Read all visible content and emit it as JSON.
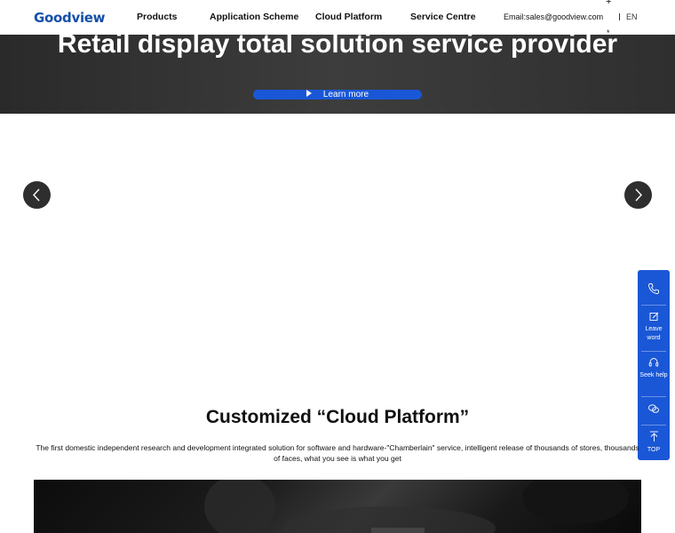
{
  "nav": {
    "logo": "Goodview",
    "items": [
      "Products",
      "Application Scheme",
      "Cloud Platform",
      "Service Centre"
    ],
    "email": "Email:sales@goodview.com",
    "lang": "EN",
    "plus_glyph": "+",
    "star_glyph": "*"
  },
  "hero": {
    "title": "Retail display total solution service provider",
    "button_label": "Learn more"
  },
  "carousel": {
    "prev_icon": "chevron-left-icon",
    "next_icon": "chevron-right-icon"
  },
  "side_widget": {
    "items": [
      {
        "icon": "phone-icon",
        "label": ""
      },
      {
        "icon": "edit-icon",
        "label": "Leave word"
      },
      {
        "icon": "headset-icon",
        "label": "Seek help"
      },
      {
        "icon": "wechat-icon",
        "label": ""
      },
      {
        "icon": "arrow-up-icon",
        "label": "TOP"
      }
    ]
  },
  "section": {
    "title": "Customized “Cloud Platform”",
    "description": "The first domestic independent research and development integrated solution for software and hardware-\"Chamberlain\" service, intelligent release of thousands of stores, thousands of faces, what you see is what you get"
  },
  "colors": {
    "brand": "#1450a8",
    "accent": "#1a57d6",
    "hero_bg": "#333333"
  }
}
